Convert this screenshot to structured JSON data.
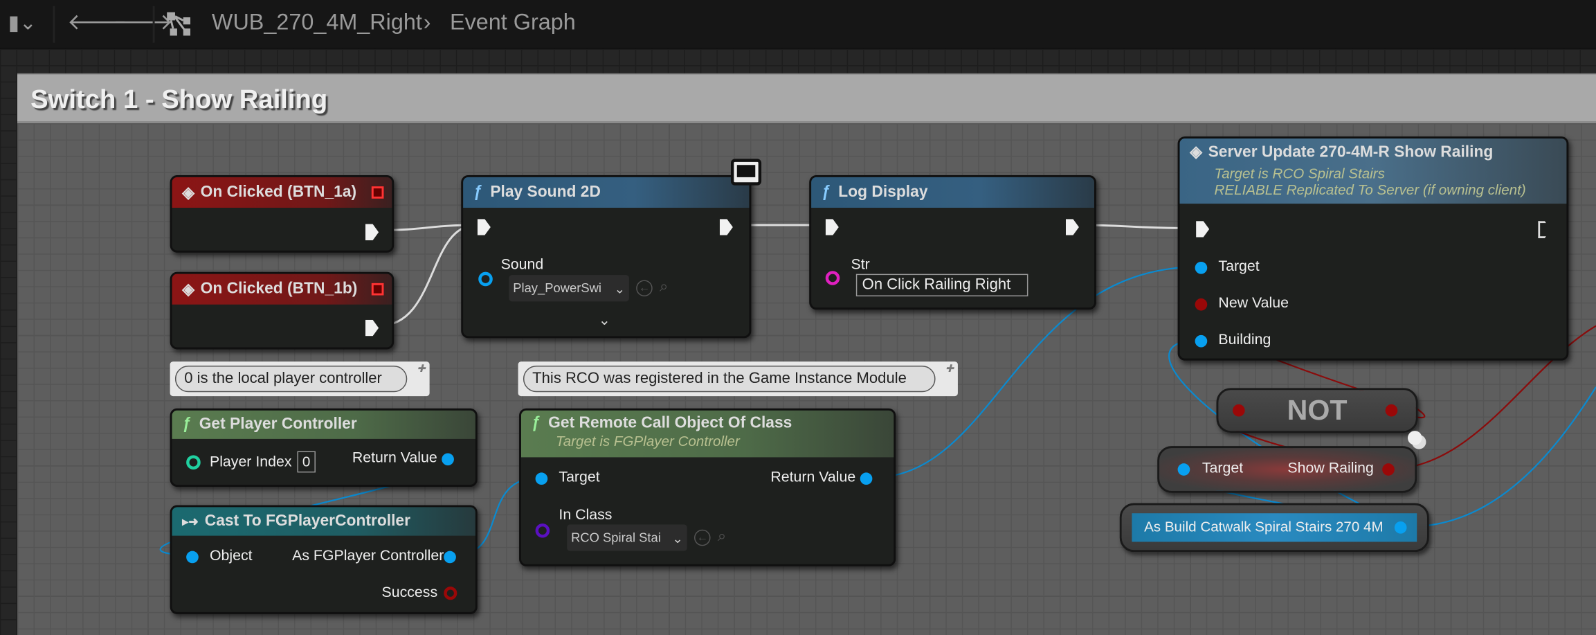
{
  "toolbar": {
    "breadcrumb_asset": "WUB_270_4M_Right",
    "breadcrumb_sep": "›",
    "breadcrumb_graph": "Event Graph"
  },
  "comment": {
    "title": "Switch 1 - Show Railing"
  },
  "nodes": {
    "on_clicked_a": {
      "title": "On Clicked (BTN_1a)"
    },
    "on_clicked_b": {
      "title": "On Clicked (BTN_1b)"
    },
    "play_sound": {
      "title": "Play Sound 2D",
      "sound_label": "Sound",
      "sound_value": "Play_PowerSwi"
    },
    "log_display": {
      "title": "Log Display",
      "str_label": "Str",
      "str_value": "On Click Railing Right"
    },
    "server_update": {
      "title": "Server Update 270-4M-R Show Railing",
      "sub1": "Target is RCO Spiral Stairs",
      "sub2": "RELIABLE Replicated To Server (if owning client)",
      "pin_target": "Target",
      "pin_new_value": "New Value",
      "pin_building": "Building"
    },
    "get_player_controller": {
      "comment": "0 is the local player controller",
      "title": "Get Player Controller",
      "pin_index": "Player Index",
      "index_value": "0",
      "pin_return": "Return Value"
    },
    "get_rco": {
      "comment": "This RCO was registered in the Game Instance Module",
      "title": "Get Remote Call Object Of Class",
      "sub": "Target is FGPlayer Controller",
      "pin_target": "Target",
      "pin_return": "Return Value",
      "pin_class": "In Class",
      "class_value": "RCO Spiral Stai"
    },
    "cast": {
      "title": "Cast To FGPlayerController",
      "pin_object": "Object",
      "pin_as": "As FGPlayer Controller",
      "pin_success": "Success"
    },
    "not": {
      "title": "NOT"
    },
    "show_railing": {
      "pin_target": "Target",
      "pin_show": "Show Railing"
    },
    "as_build": {
      "title": "As Build Catwalk Spiral Stairs 270 4M"
    }
  },
  "colors": {
    "exec": "#f2f2f2",
    "object_pin": "#08a0f0",
    "bool_pin": "#9a0808",
    "string_pin": "#e020c0",
    "int_pin": "#20d0a0",
    "class_pin": "#5a10c0"
  }
}
